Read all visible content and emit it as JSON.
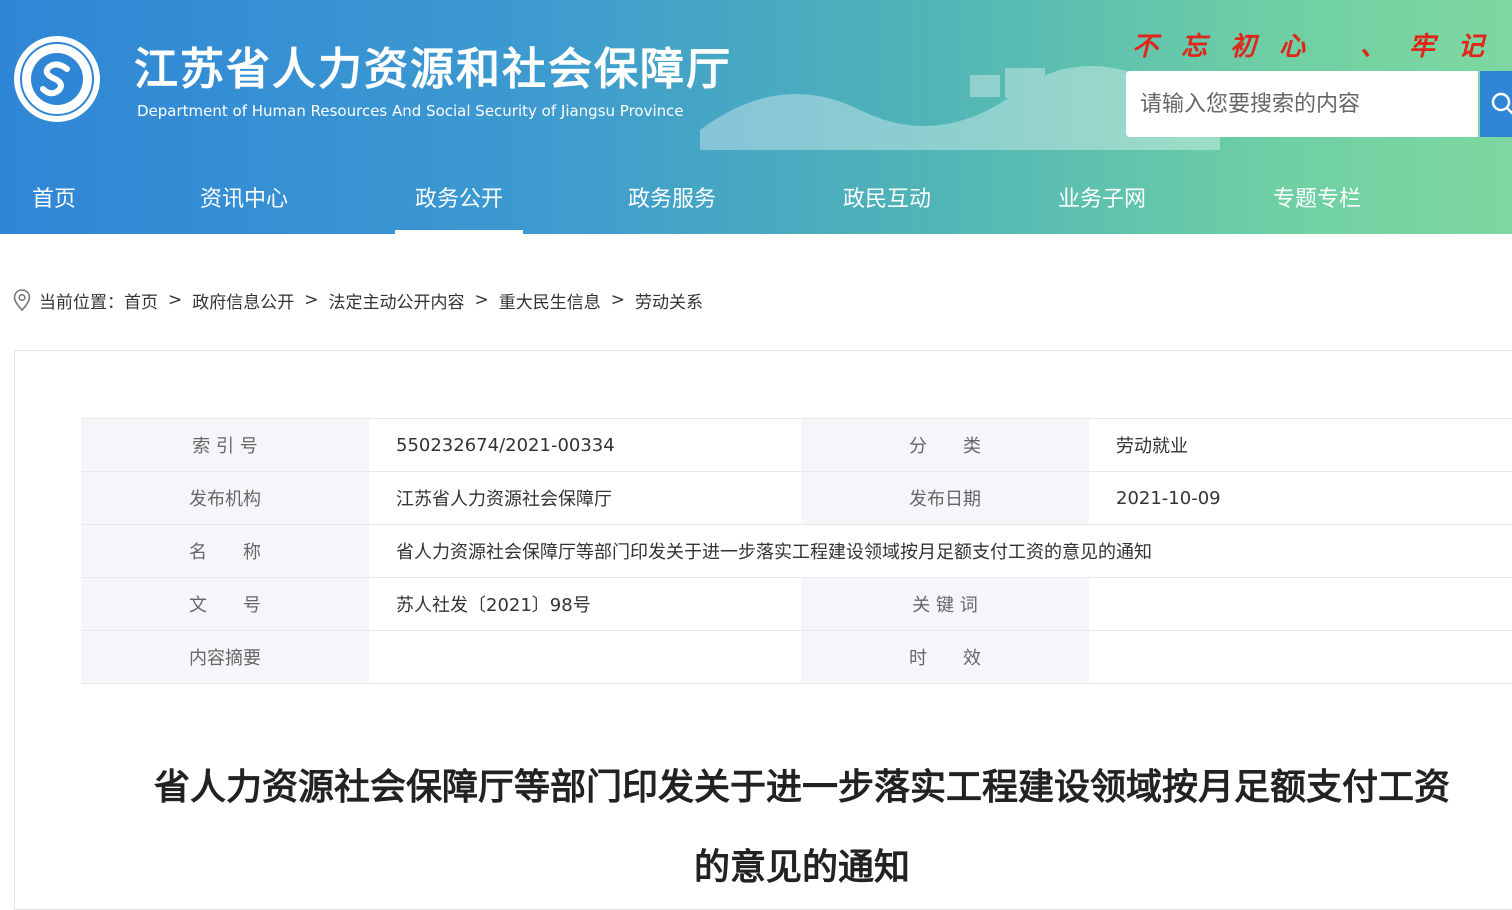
{
  "header": {
    "title": "江苏省人力资源和社会保障厅",
    "subtitle": "Department of Human Resources And Social Security of Jiangsu Province",
    "slogan": "不忘初心 、牢记",
    "search_placeholder": "请输入您要搜索的内容",
    "colors": {
      "gradient_start": "#2f86d6",
      "gradient_end": "#7ed7a0",
      "slogan": "#e0261b"
    }
  },
  "nav": {
    "items": [
      {
        "label": "首页"
      },
      {
        "label": "资讯中心"
      },
      {
        "label": "政务公开"
      },
      {
        "label": "政务服务"
      },
      {
        "label": "政民互动"
      },
      {
        "label": "业务子网"
      },
      {
        "label": "专题专栏"
      }
    ],
    "active": "政务公开"
  },
  "breadcrumb": {
    "prefix": "当前位置：",
    "items": [
      "首页",
      "政府信息公开",
      "法定主动公开内容",
      "重大民生信息",
      "劳动关系"
    ]
  },
  "meta": {
    "rows": [
      {
        "label1": "索 引 号",
        "value1": "550232674/2021-00334",
        "label2": "分　　类",
        "value2": "劳动就业"
      },
      {
        "label1": "发布机构",
        "value1": "江苏省人力资源社会保障厅",
        "label2": "发布日期",
        "value2": "2021-10-09"
      },
      {
        "label1": "名　　称",
        "value1": "省人力资源社会保障厅等部门印发关于进一步落实工程建设领域按月足额支付工资的意见的通知"
      },
      {
        "label1": "文　　号",
        "value1": "苏人社发〔2021〕98号",
        "label2": "关 键 词",
        "value2": ""
      },
      {
        "label1": "内容摘要",
        "value1": "",
        "label2": "时　　效",
        "value2": ""
      }
    ]
  },
  "article": {
    "title_line1": "省人力资源社会保障厅等部门印发关于进一步落实工程建设领域按月足额支付工资",
    "title_line2": "的意见的通知"
  }
}
